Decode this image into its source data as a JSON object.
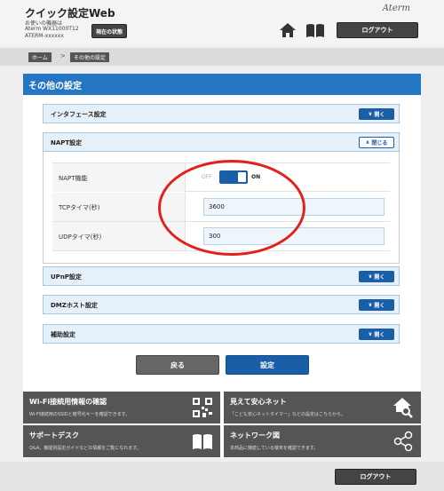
{
  "header": {
    "app_title": "クイック設定Web",
    "device_label": "お使いの機器は",
    "device_model": "Aterm WX11000T12",
    "device_id": "ATERM-xxxxxx",
    "status_button": "現在の状態",
    "brand": "Aterm",
    "logout_label": "ログアウト"
  },
  "breadcrumb": {
    "home": "ホーム",
    "separator": ">",
    "current": "その他の設定"
  },
  "page_title": "その他の設定",
  "sections": {
    "interface": {
      "label": "インタフェース設定",
      "button": "開く"
    },
    "napt": {
      "label": "NAPT設定",
      "button": "閉じる"
    },
    "upnp": {
      "label": "UPnP設定",
      "button": "開く"
    },
    "dmz": {
      "label": "DMZホスト設定",
      "button": "開く"
    },
    "aux": {
      "label": "補助設定",
      "button": "開く"
    }
  },
  "napt": {
    "function_label": "NAPT機能",
    "switch_off": "OFF",
    "switch_on": "ON",
    "switch_state": "ON",
    "tcp_label": "TCPタイマ(秒)",
    "tcp_value": "3600",
    "udp_label": "UDPタイマ(秒)",
    "udp_value": "300"
  },
  "actions": {
    "back": "戻る",
    "submit": "設定"
  },
  "tiles": {
    "wifi": {
      "title": "Wi-Fi接続用情報の確認",
      "desc": "Wi-Fi接続用のSSIDと暗号化キーを確認できます。",
      "icon": "qr-code-icon"
    },
    "mimamori": {
      "title": "見えて安心ネット",
      "desc": "「こども安心ネットタイマー」などの設定はこちらから。",
      "icon": "home-search-icon"
    },
    "support": {
      "title": "サポートデスク",
      "desc": "Q&A、機能別設定ガイドなどの情報をご覧になれます。",
      "icon": "open-book-icon"
    },
    "network": {
      "title": "ネットワーク図",
      "desc": "本商品に接続している端末を確認できます。",
      "icon": "network-share-icon"
    }
  },
  "footer": {
    "logout_label": "ログアウト"
  },
  "colors": {
    "accent": "#2476c4",
    "button_blue": "#1b5ea8",
    "highlight": "#e3201b",
    "tile_bg": "#555555"
  }
}
